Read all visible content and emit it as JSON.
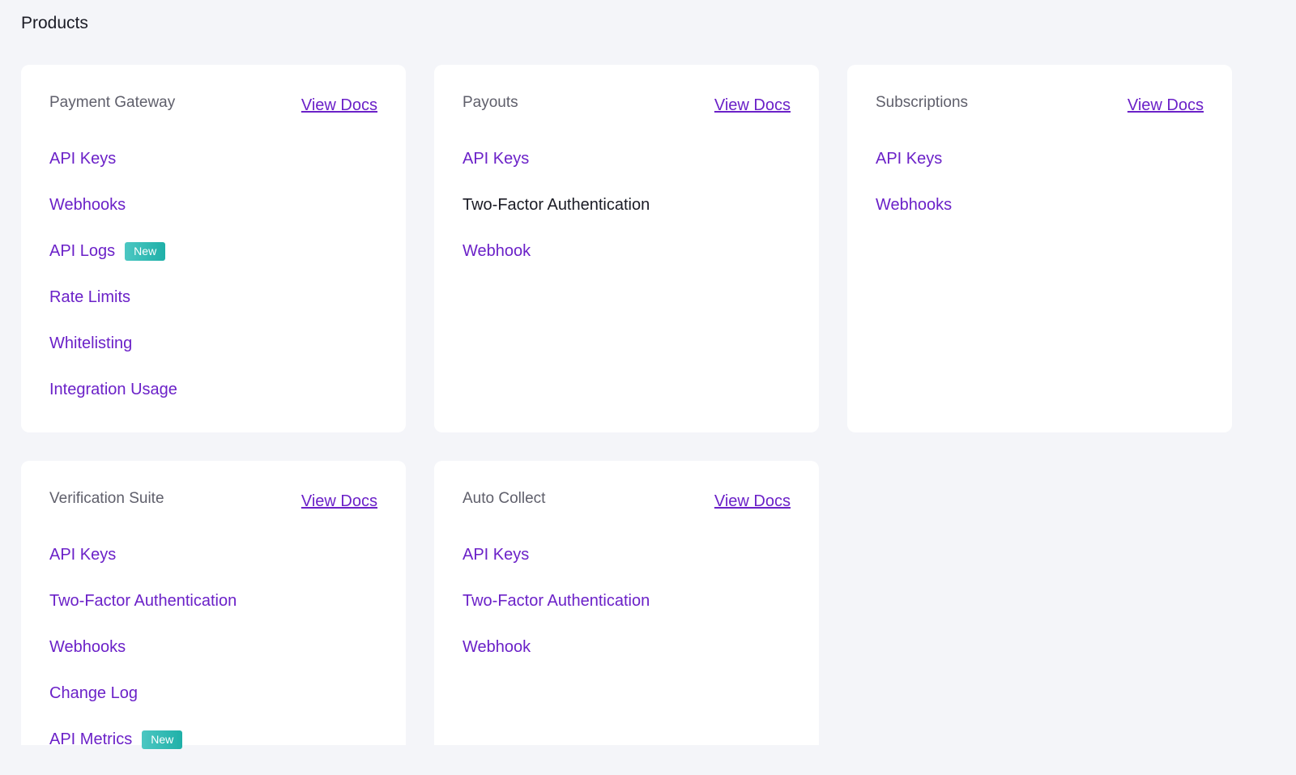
{
  "page": {
    "title": "Products"
  },
  "cards": [
    {
      "title": "Payment Gateway",
      "view_docs": "View Docs",
      "items": [
        {
          "label": "API Keys"
        },
        {
          "label": "Webhooks"
        },
        {
          "label": "API Logs",
          "badge": "New"
        },
        {
          "label": "Rate Limits"
        },
        {
          "label": "Whitelisting"
        },
        {
          "label": "Integration Usage"
        }
      ]
    },
    {
      "title": "Payouts",
      "view_docs": "View Docs",
      "items": [
        {
          "label": "API Keys"
        },
        {
          "label": "Two-Factor Authentication",
          "state": "hovered"
        },
        {
          "label": "Webhook"
        }
      ]
    },
    {
      "title": "Subscriptions",
      "view_docs": "View Docs",
      "items": [
        {
          "label": "API Keys"
        },
        {
          "label": "Webhooks"
        }
      ]
    },
    {
      "title": "Verification Suite",
      "view_docs": "View Docs",
      "items": [
        {
          "label": "API Keys"
        },
        {
          "label": "Two-Factor Authentication"
        },
        {
          "label": "Webhooks"
        },
        {
          "label": "Change Log"
        },
        {
          "label": "API Metrics",
          "badge": "New"
        }
      ]
    },
    {
      "title": "Auto Collect",
      "view_docs": "View Docs",
      "items": [
        {
          "label": "API Keys"
        },
        {
          "label": "Two-Factor Authentication"
        },
        {
          "label": "Webhook"
        }
      ]
    }
  ],
  "colors": {
    "link": "#6b21c8",
    "background": "#f4f5f9",
    "badge": "#2bb7b0"
  }
}
